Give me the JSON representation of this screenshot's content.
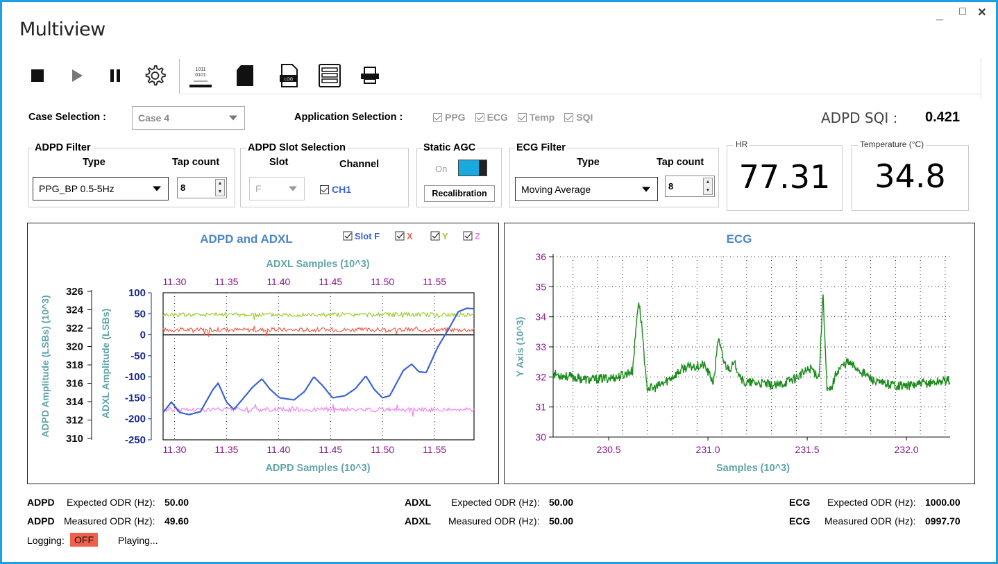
{
  "window": {
    "title": "Multiview",
    "minimize": "_",
    "maximize": "□",
    "close": "✕"
  },
  "toolbar": {
    "icons": [
      "stop-icon",
      "play-icon",
      "pause-icon",
      "settings-icon",
      "binary-log-icon",
      "sd-card-icon",
      "log-file-icon",
      "list-icon",
      "usb-icon"
    ],
    "binary_text": "1011\n0101",
    "log_text": "LOG"
  },
  "case": {
    "label": "Case Selection :",
    "value": "Case 4"
  },
  "app": {
    "label": "Application Selection :",
    "items": [
      "PPG",
      "ECG",
      "Temp",
      "SQI"
    ]
  },
  "sqi": {
    "label": "ADPD SQI :",
    "value": "0.421"
  },
  "adpd_filter": {
    "group": "ADPD Filter",
    "type_label": "Type",
    "tap_label": "Tap count",
    "type_value": "PPG_BP 0.5-5Hz",
    "tap_value": "8"
  },
  "slot_sel": {
    "group": "ADPD Slot Selection",
    "slot_label": "Slot",
    "channel_label": "Channel",
    "slot_value": "F",
    "channel_value": "CH1"
  },
  "agc": {
    "group": "Static AGC",
    "state": "On",
    "button": "Recalibration"
  },
  "ecg_filter": {
    "group": "ECG Filter",
    "type_label": "Type",
    "tap_label": "Tap count",
    "type_value": "Moving Average",
    "tap_value": "8"
  },
  "hr": {
    "label": "HR",
    "value": "77.31"
  },
  "temp": {
    "label": "Temperature (°C)",
    "value": "34.8"
  },
  "chart_data": [
    {
      "type": "line",
      "title": "ADPD and ADXL",
      "legend": [
        "Slot F",
        "X",
        "Y",
        "Z"
      ],
      "top_axis_label": "ADXL Samples (10^3)",
      "x_ticks": [
        "11.30",
        "11.35",
        "11.40",
        "11.45",
        "11.50",
        "11.55"
      ],
      "xlabel": "ADPD Samples (10^3)",
      "ylabel_left": "ADPD Amplitude (LSBs) (10^3)",
      "ylabel_right": "ADXL Amplitude (LSBs)",
      "adpd_ticks": [
        "326",
        "324",
        "322",
        "320",
        "318",
        "316",
        "314",
        "312",
        "310"
      ],
      "adxl_ticks": [
        "100",
        "50",
        "0",
        "-50",
        "-100",
        "-150",
        "-200",
        "-250"
      ],
      "xlim": [
        11.289,
        11.588
      ],
      "adxl_ylim": [
        -250,
        100
      ],
      "colors": {
        "slot_f": "#3b63d6",
        "x": "#f0604a",
        "y": "#9acd32",
        "z": "#ee82ee"
      },
      "series": [
        {
          "name": "Slot F",
          "x": [
            11.289,
            11.297,
            11.305,
            11.314,
            11.325,
            11.337,
            11.342,
            11.35,
            11.357,
            11.375,
            11.384,
            11.392,
            11.401,
            11.415,
            11.425,
            11.434,
            11.442,
            11.452,
            11.464,
            11.474,
            11.484,
            11.492,
            11.5,
            11.507,
            11.52,
            11.528,
            11.535,
            11.542,
            11.553,
            11.565,
            11.573,
            11.581,
            11.588
          ],
          "y": [
            -185,
            -160,
            -185,
            -190,
            -183,
            -130,
            -115,
            -160,
            -178,
            -125,
            -105,
            -130,
            -150,
            -155,
            -135,
            -100,
            -120,
            -150,
            -145,
            -128,
            -98,
            -130,
            -150,
            -145,
            -85,
            -70,
            -88,
            -90,
            -30,
            20,
            55,
            63,
            62
          ]
        },
        {
          "name": "X",
          "base": 12
        },
        {
          "name": "Y",
          "base": 48
        },
        {
          "name": "Z",
          "base": -178
        }
      ]
    },
    {
      "type": "line",
      "title": "ECG",
      "xlabel": "Samples  (10^3)",
      "ylabel": "Y Axis (10^3)",
      "x_ticks": [
        "230.5",
        "231.0",
        "231.5",
        "232.0"
      ],
      "y_ticks": [
        "36",
        "35",
        "34",
        "33",
        "32",
        "31",
        "30"
      ],
      "xlim": [
        230.22,
        232.22
      ],
      "ylim": [
        30,
        36
      ],
      "color": "#1a8a1a",
      "series": [
        {
          "name": "ECG",
          "x": [
            230.22,
            230.4,
            230.55,
            230.62,
            230.65,
            230.67,
            230.69,
            230.72,
            230.78,
            230.88,
            230.98,
            231.03,
            231.05,
            231.08,
            231.1,
            231.14,
            231.18,
            231.25,
            231.35,
            231.45,
            231.52,
            231.56,
            231.58,
            231.6,
            231.62,
            231.65,
            231.7,
            231.75,
            231.85,
            232.0,
            232.22
          ],
          "y": [
            32.1,
            31.9,
            32.0,
            32.2,
            34.6,
            33.5,
            31.7,
            31.6,
            31.8,
            32.3,
            32.4,
            31.8,
            33.3,
            32.5,
            32.3,
            32.4,
            31.8,
            31.8,
            31.7,
            32.0,
            32.3,
            32.0,
            34.8,
            31.5,
            31.6,
            32.2,
            32.5,
            32.3,
            31.8,
            31.7,
            31.9
          ]
        }
      ]
    }
  ],
  "stats": {
    "adpd_label": "ADPD",
    "adxl_label": "ADXL",
    "ecg_label": "ECG",
    "expected_label": "Expected ODR (Hz):",
    "measured_label": "Measured ODR (Hz):",
    "adpd_expected": "50.00",
    "adpd_measured": "49.60",
    "adxl_expected": "50.00",
    "adxl_measured": "50.00",
    "ecg_expected": "1000.00",
    "ecg_measured": "0997.70"
  },
  "status": {
    "logging_label": "Logging:",
    "logging_value": "OFF",
    "playing": "Playing..."
  }
}
